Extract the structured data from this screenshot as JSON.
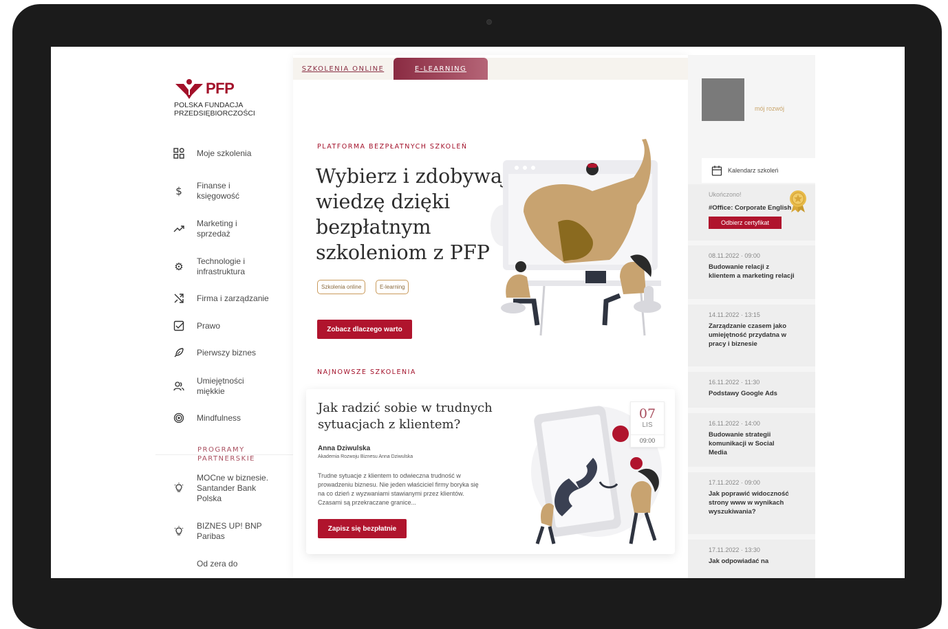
{
  "sidebar": {
    "logo_text": "PFP",
    "logo_sub_line1": "POLSKA FUNDACJA",
    "logo_sub_line2": "PRZEDSIĘBIORCZOŚCI",
    "items": [
      {
        "label": "Moje szkolenia",
        "icon": "grid-icon"
      },
      {
        "label": "Finanse i księgowość",
        "icon": "dollar-icon"
      },
      {
        "label": "Marketing i sprzedaż",
        "icon": "trend-up-icon"
      },
      {
        "label": "Technologie i infrastruktura",
        "icon": "gear-icon"
      },
      {
        "label": "Firma i zarządzanie",
        "icon": "shuffle-icon"
      },
      {
        "label": "Prawo",
        "icon": "checkbox-icon"
      },
      {
        "label": "Pierwszy biznes",
        "icon": "feather-icon"
      },
      {
        "label": "Umiejętności miękkie",
        "icon": "users-icon"
      },
      {
        "label": "Mindfulness",
        "icon": "target-icon"
      }
    ],
    "partners_title": "PROGRAMY PARTNERSKIE",
    "partners": [
      {
        "label": "MOCne w biznesie. Santander Bank Polska",
        "icon": "lightbulb-icon"
      },
      {
        "label": "BIZNES UP! BNP Paribas",
        "icon": "lightbulb-icon"
      },
      {
        "label": "Od zera do",
        "icon": ""
      }
    ]
  },
  "tabs": {
    "online": "SZKOLENIA ONLINE",
    "elearning": "E-LEARNING"
  },
  "hero": {
    "eyebrow": "PLATFORMA BEZPŁATNYCH SZKOLEŃ",
    "title": "Wybierz i zdobywaj wiedzę dzięki bezpłatnym szkoleniom z PFP",
    "pill_online": "Szkolenia online",
    "pill_elearning": "E-learning",
    "cta": "Zobacz dlaczego warto"
  },
  "latest": {
    "eyebrow": "NAJNOWSZE SZKOLENIA",
    "card": {
      "title": "Jak radzić sobie w trudnych sytuacjach z klientem?",
      "author": "Anna Dziwulska",
      "org": "Akademia Rozwoju Biznesu Anna Dziwulska",
      "description": "Trudne sytuacje z klientem to odwieczna trudność w prowadzeniu biznesu. Nie jeden właściciel firmy boryka się na co dzień z wyzwaniami stawianymi przez klientów. Czasami są przekraczane granice...",
      "date_day": "07",
      "date_month": "LIS",
      "date_time": "09:00",
      "cta": "Zapisz się bezpłatnie"
    }
  },
  "right": {
    "my_development": "mój rozwój",
    "calendar_label": "Kalendarz szkoleń",
    "completed": {
      "label": "Ukończono!",
      "title": "#Office: Corporate English",
      "cta": "Odbierz certyfikat"
    },
    "events": [
      {
        "date": "08.11.2022 · 09:00",
        "title": "Budowanie relacji z klientem a marketing relacji"
      },
      {
        "date": "14.11.2022 · 13:15",
        "title": "Zarządzanie czasem jako umiejętność przydatna w pracy i biznesie"
      },
      {
        "date": "16.11.2022 · 11:30",
        "title": "Podstawy Google Ads"
      },
      {
        "date": "16.11.2022 · 14:00",
        "title": "Budowanie strategii komunikacji w Social Media"
      },
      {
        "date": "17.11.2022 · 09:00",
        "title": "Jak poprawić widoczność strony www w wynikach wyszukiwania?"
      },
      {
        "date": "17.11.2022 · 13:30",
        "title": "Jak odpowiadać na"
      }
    ]
  },
  "colors": {
    "brand_red": "#b0142d",
    "accent_mauve": "#a84d5d",
    "gold": "#c9a46a"
  }
}
